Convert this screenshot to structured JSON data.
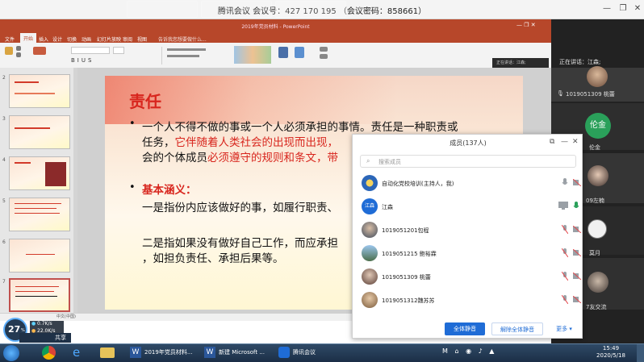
{
  "meeting": {
    "title": "腾讯会议 会议号：427 170 195 （会议密码：858661）"
  },
  "ppt": {
    "window_title": "2019年党员材料 - PowerPoint",
    "tabs": [
      "文件",
      "开始",
      "插入",
      "设计",
      "切换",
      "动画",
      "幻灯片放映",
      "审阅",
      "视图",
      "告诉我您想要做什么..."
    ],
    "active_tab": "开始",
    "status_text": "中文(中国)",
    "thumb_numbers": [
      "2",
      "3",
      "4",
      "5",
      "6",
      "7"
    ]
  },
  "slide": {
    "title": "责任",
    "p1_line1": "一个人不得不做的事或一个人必须承担的事情。责任是一种职责或",
    "p1_line2_a": "任务，",
    "p1_line2_red": "它伴随着人类社会的出现而出现，",
    "p1_line3_a": "会的个体成员",
    "p1_line3_red": "必须遵守的规则和条文，",
    "p1_line3_b": "带",
    "basic_label": "基本涵义：",
    "meaning1": "一是指份内应该做好的事，如履行职责、",
    "meaning2_line1": "二是指如果没有做好自己工作，而应承担",
    "meaning2_line2": "，如担负责任、承担后果等。"
  },
  "video": {
    "speaking_now": "正在讲话：江森;",
    "tile1_name": "1019051309 桃蕾",
    "tile2_avatar_text": "伦金",
    "tile2_name": "伦金",
    "tile3_name": "09左楠",
    "tile4_name": "莫月",
    "tile5_name": "7友交流"
  },
  "panel": {
    "title": "成员(137人)",
    "search_placeholder": "搜索成员",
    "members": [
      {
        "name": "自动化党校培训(主持人，我)",
        "avatar": "logo"
      },
      {
        "name": "江森",
        "avatar": "江森"
      },
      {
        "name": "1019051201包程",
        "avatar": "photo"
      },
      {
        "name": "1019051215 鲍裕霖",
        "avatar": "photo"
      },
      {
        "name": "1019051309 桃蕾",
        "avatar": "photo"
      },
      {
        "name": "1019051312魏苏苏",
        "avatar": "photo"
      }
    ],
    "mute_all": "全体静音",
    "unmute_all": "解除全体静音",
    "more": "更多"
  },
  "network": {
    "percent": "27",
    "up": "0.7K/s",
    "down": "22.0K/s",
    "share_label": "共享"
  },
  "taskbar": {
    "tasks": [
      "2019年党员材料...",
      "新建 Microsoft ...",
      "腾讯会议"
    ],
    "time": "15:49",
    "date": "2020/5/18"
  },
  "colors": {
    "ppt_accent": "#b7472a",
    "slide_red": "#d8261e",
    "button_blue": "#1f6cd6"
  }
}
